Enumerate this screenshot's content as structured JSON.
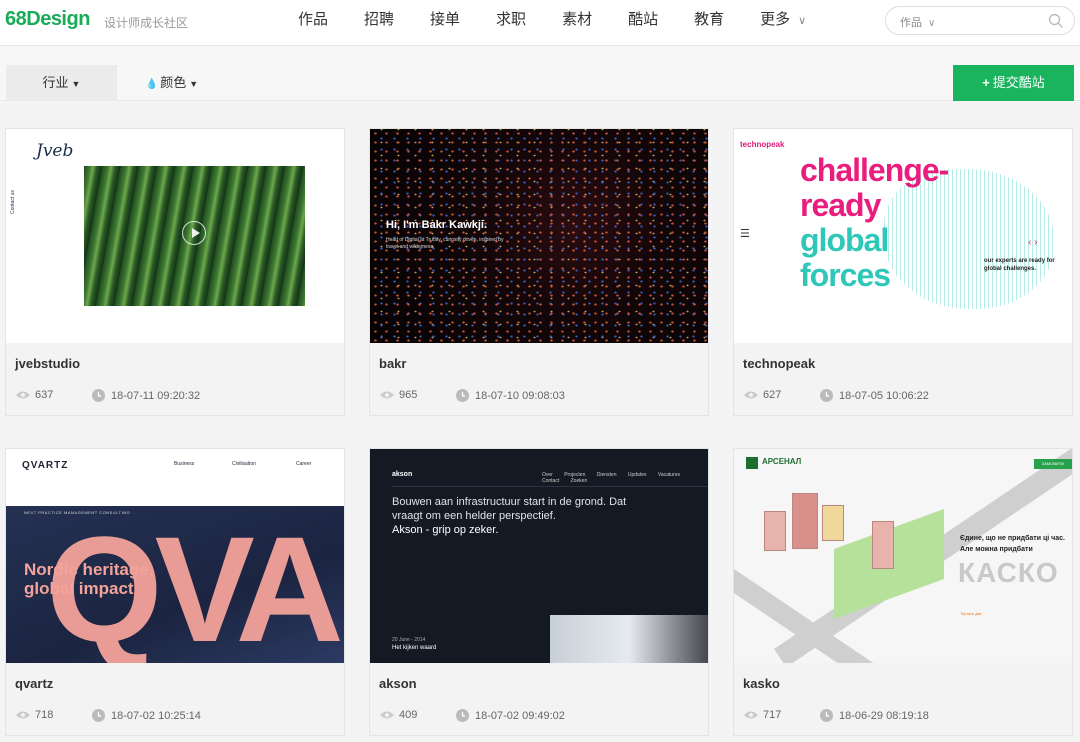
{
  "header": {
    "logo": "68Design",
    "slogan": "设计师成长社区",
    "nav": [
      "作品",
      "招聘",
      "接单",
      "求职",
      "素材",
      "酷站",
      "教育",
      "更多"
    ],
    "search": {
      "scope": "作品",
      "placeholder": ""
    }
  },
  "filters": {
    "industry": "行业",
    "color": "颜色",
    "submit": "提交酷站"
  },
  "cards": [
    {
      "name": "jvebstudio",
      "views": "637",
      "time": "18-07-11 09:20:32",
      "preview": {
        "brand": "Jveb",
        "side": "Contact us"
      }
    },
    {
      "name": "bakr",
      "views": "965",
      "time": "18-07-10 09:08:03",
      "preview": {
        "headline": "Hi, I'm Bakr Kawkji.",
        "sub": "Head of Digital at Trudity, curiosity driven, inspired by travel and wilderness."
      }
    },
    {
      "name": "technopeak",
      "views": "627",
      "time": "18-07-05 10:06:22",
      "preview": {
        "logo": "technopeak",
        "line1": "challenge-",
        "line2": "ready",
        "line3": "global",
        "line4": "forces",
        "tagline": "our experts are ready for global challenges."
      }
    },
    {
      "name": "qvartz",
      "views": "718",
      "time": "18-07-02 10:25:14",
      "preview": {
        "logo": "QVARTZ",
        "nav": [
          "Business",
          "Civilisation",
          "Career"
        ],
        "label": "NEXT PRACTICE MANAGEMENT CONSULTING",
        "headline1": "Nordic heritage,",
        "headline2": "global impact",
        "bigletters": "QVA"
      }
    },
    {
      "name": "akson",
      "views": "409",
      "time": "18-07-02 09:49:02",
      "preview": {
        "logo": "akson",
        "nav": "Over Projecten Diensten Updates Vacatures Contact Zoeken",
        "text": "Bouwen aan infrastructuur start in de grond. Dat vraagt om een helder perspectief.",
        "bold": "Akson - grip op zeker.",
        "date": "20 June - 2014",
        "watch": "Het kijken waard"
      }
    },
    {
      "name": "kasko",
      "views": "717",
      "time": "18-06-29 08:19:18",
      "preview": {
        "logo": "АРСЕНАЛ",
        "button": "ЗАМОВИТИ",
        "line": "Єдине, що не придбати ці час. Але можна придбати",
        "big": "КАСКО",
        "link": "Торгати дім"
      }
    }
  ]
}
